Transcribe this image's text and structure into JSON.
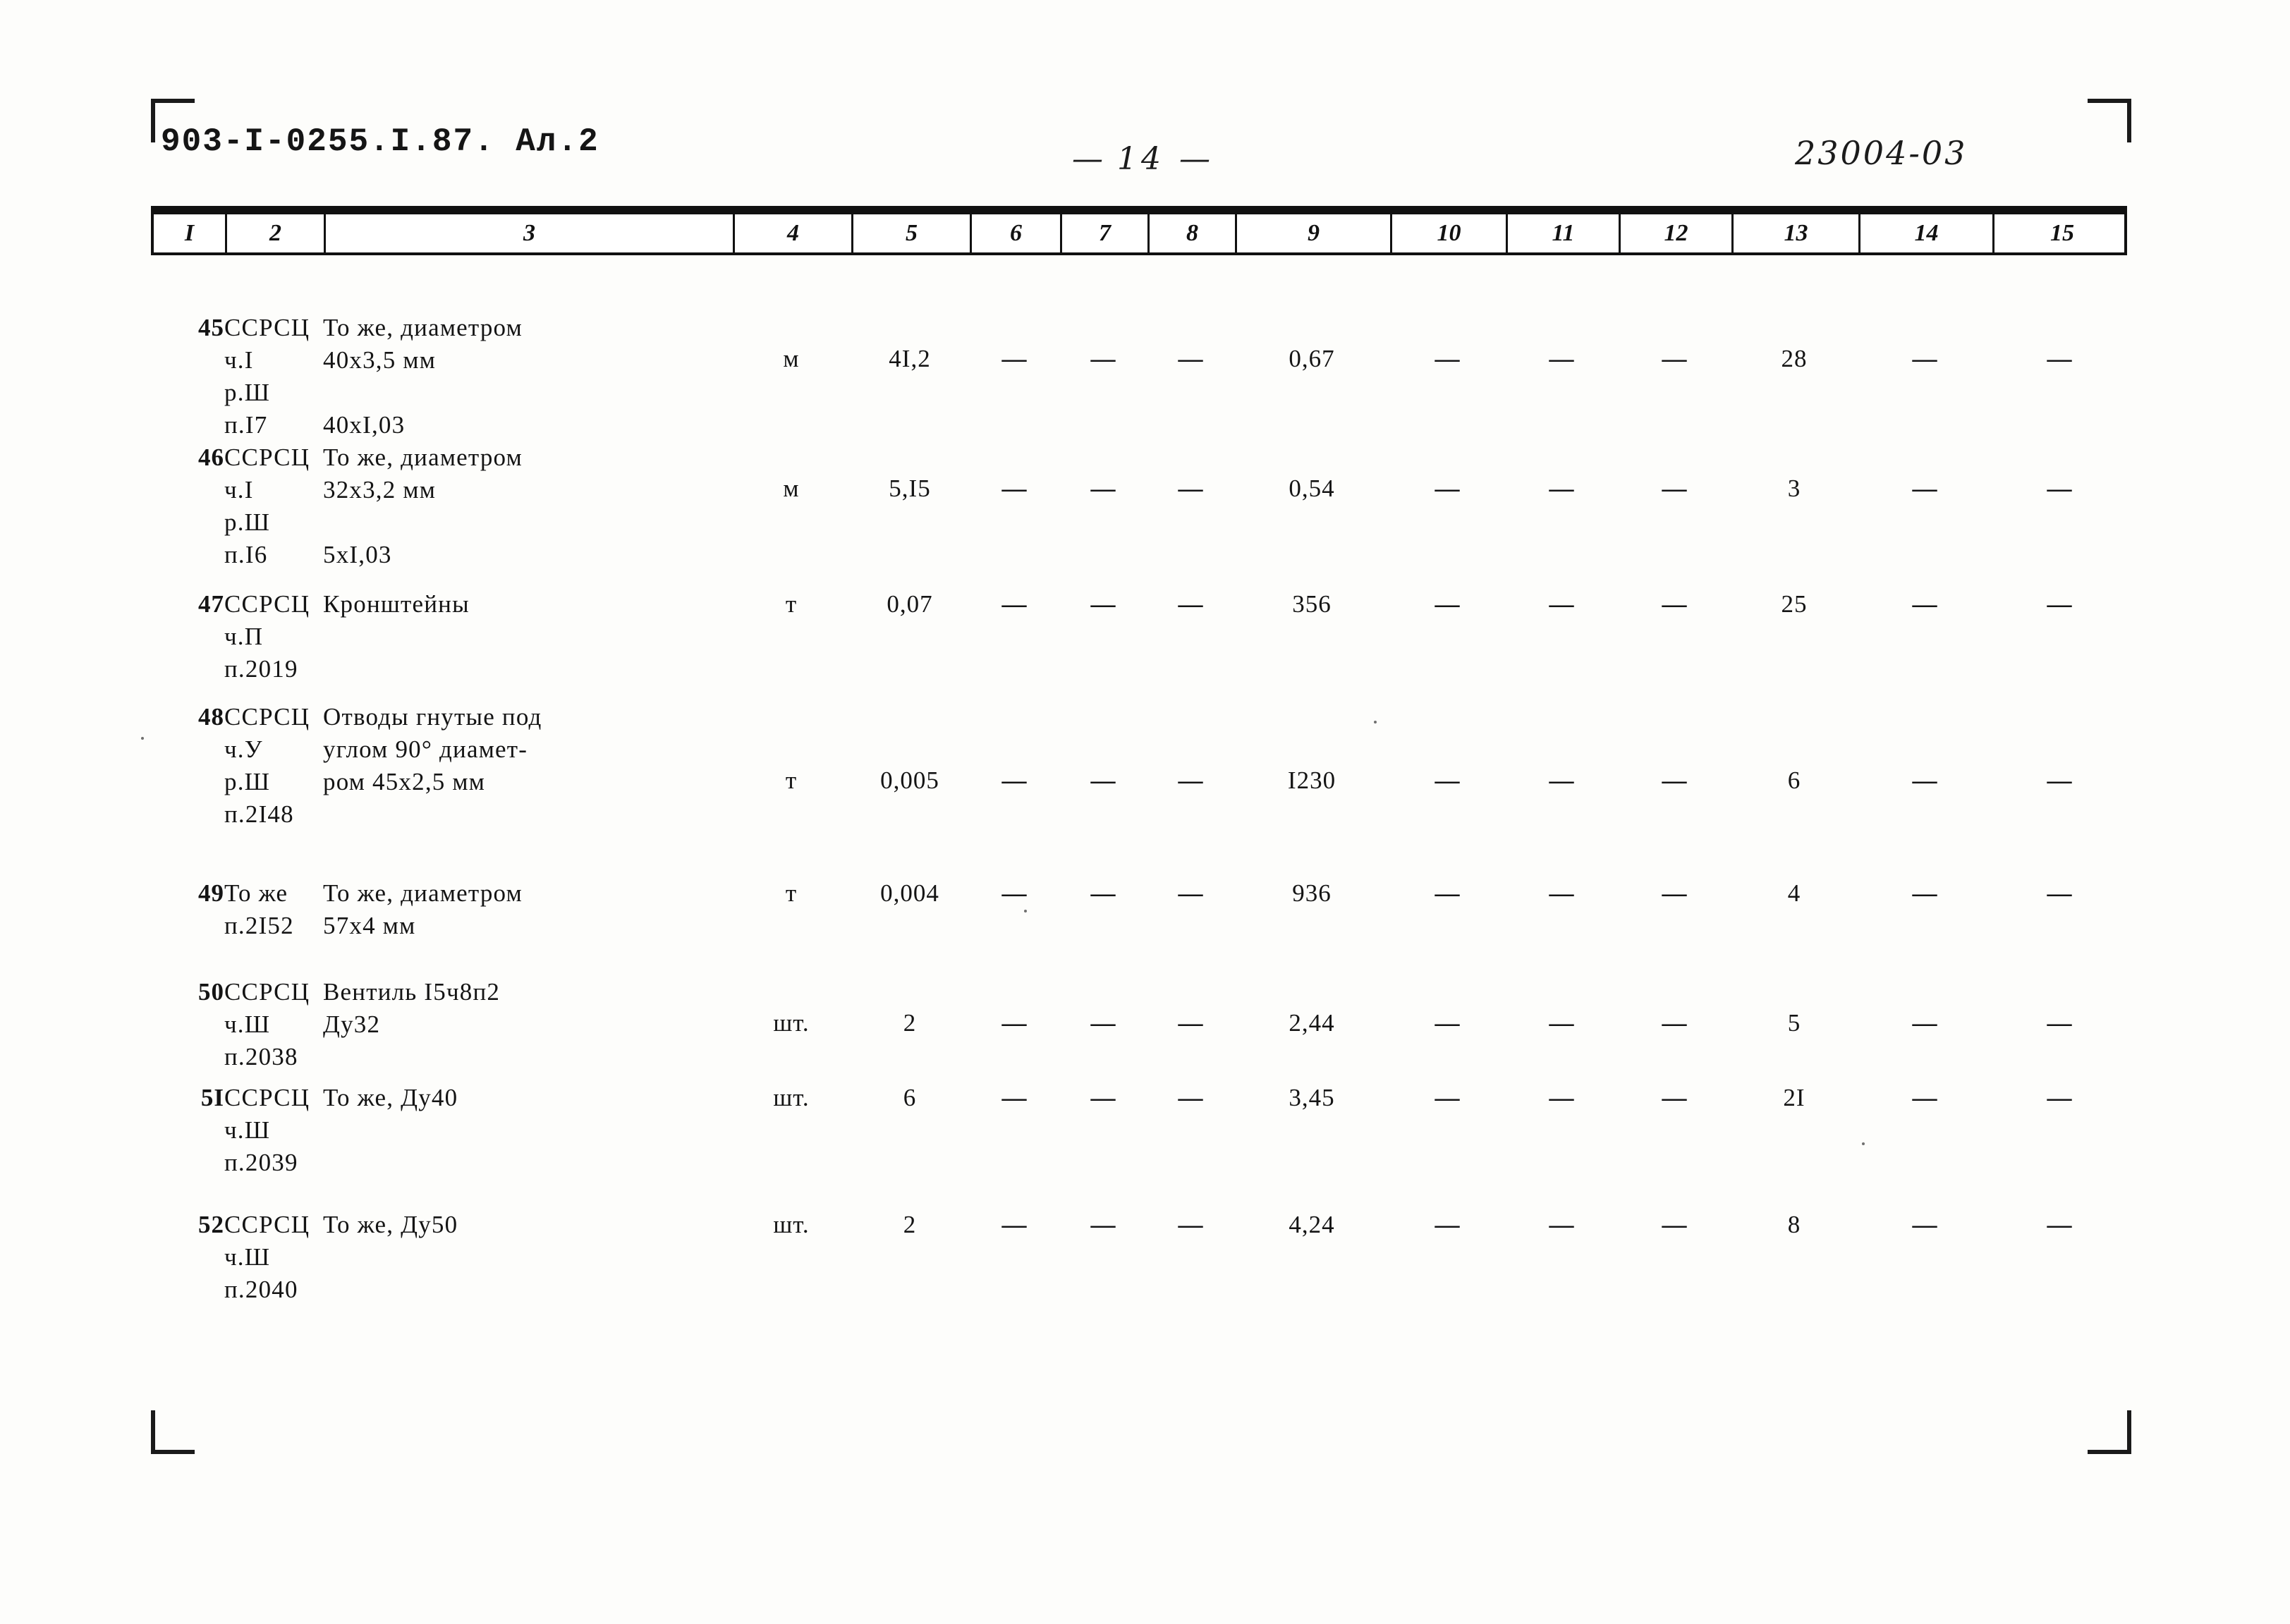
{
  "header": {
    "code_left": "903-I-0255.I.87. Ал.2",
    "page_number": "14",
    "code_right": "23004-03"
  },
  "table": {
    "column_headers": [
      "I",
      "2",
      "3",
      "4",
      "5",
      "6",
      "7",
      "8",
      "9",
      "10",
      "11",
      "12",
      "13",
      "14",
      "15"
    ],
    "dash_glyph": "—",
    "rows": [
      {
        "n": "45",
        "justification": "ССРСЦ\nч.I\nр.Ш\nп.I7",
        "name": "То же, диаметром\n40х3,5 мм\n\n40хI,03",
        "unit": "м",
        "c5": "4I,2",
        "c6": "—",
        "c7": "—",
        "c8": "—",
        "c9": "0,67",
        "c10": "—",
        "c11": "—",
        "c12": "—",
        "c13": "28",
        "c14": "—",
        "c15": "—"
      },
      {
        "n": "46",
        "justification": "ССРСЦ\nч.I\nр.Ш\nп.I6",
        "name": "То же, диаметром\n32х3,2 мм\n\n5хI,03",
        "unit": "м",
        "c5": "5,I5",
        "c6": "—",
        "c7": "—",
        "c8": "—",
        "c9": "0,54",
        "c10": "—",
        "c11": "—",
        "c12": "—",
        "c13": "3",
        "c14": "—",
        "c15": "—"
      },
      {
        "n": "47",
        "justification": "ССРСЦ\nч.П\nп.2019",
        "name": "Кронштейны",
        "unit": "т",
        "c5": "0,07",
        "c6": "—",
        "c7": "—",
        "c8": "—",
        "c9": "356",
        "c10": "—",
        "c11": "—",
        "c12": "—",
        "c13": "25",
        "c14": "—",
        "c15": "—"
      },
      {
        "n": "48",
        "justification": "ССРСЦ\nч.У\nр.Ш\nп.2I48",
        "name": "Отводы гнутые под\nуглом  90° диамет-\nром 45х2,5 мм",
        "unit": "т",
        "c5": "0,005",
        "c6": "—",
        "c7": "—",
        "c8": "—",
        "c9": "I230",
        "c10": "—",
        "c11": "—",
        "c12": "—",
        "c13": "6",
        "c14": "—",
        "c15": "—"
      },
      {
        "n": "49",
        "justification": "То же\nп.2I52",
        "name": "То же, диаметром\n57х4 мм",
        "unit": "т",
        "c5": "0,004",
        "c6": "—",
        "c7": "—",
        "c8": "—",
        "c9": "936",
        "c10": "—",
        "c11": "—",
        "c12": "—",
        "c13": "4",
        "c14": "—",
        "c15": "—"
      },
      {
        "n": "50",
        "justification": "ССРСЦ\nч.Ш\nп.2038",
        "name": "Вентиль I5ч8п2\nДу32",
        "unit": "шт.",
        "c5": "2",
        "c6": "—",
        "c7": "—",
        "c8": "—",
        "c9": "2,44",
        "c10": "—",
        "c11": "—",
        "c12": "—",
        "c13": "5",
        "c14": "—",
        "c15": "—"
      },
      {
        "n": "5I",
        "justification": "ССРСЦ\nч.Ш\nп.2039",
        "name": "То же, Ду40",
        "unit": "шт.",
        "c5": "6",
        "c6": "—",
        "c7": "—",
        "c8": "—",
        "c9": "3,45",
        "c10": "—",
        "c11": "—",
        "c12": "—",
        "c13": "2I",
        "c14": "—",
        "c15": "—"
      },
      {
        "n": "52",
        "justification": "ССРСЦ\nч.Ш\nп.2040",
        "name": "То же, Ду50",
        "unit": "шт.",
        "c5": "2",
        "c6": "—",
        "c7": "—",
        "c8": "—",
        "c9": "4,24",
        "c10": "—",
        "c11": "—",
        "c12": "—",
        "c13": "8",
        "c14": "—",
        "c15": "—"
      }
    ]
  }
}
